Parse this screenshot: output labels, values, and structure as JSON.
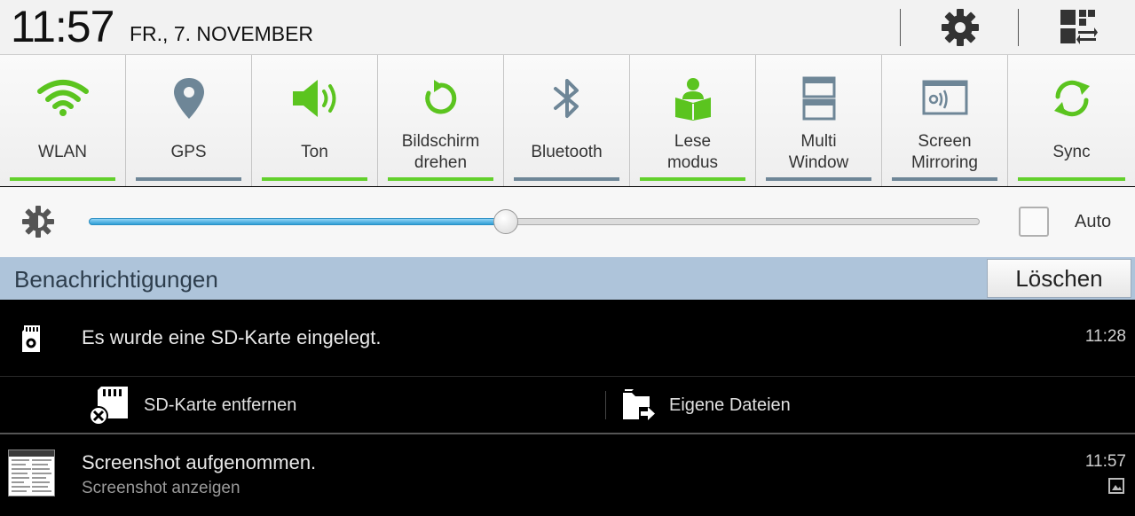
{
  "status": {
    "time": "11:57",
    "date": "FR., 7. NOVEMBER"
  },
  "header_icons": {
    "settings": "gear-icon",
    "multiwindow": "multi-window-icon"
  },
  "toggles": [
    {
      "label": "WLAN",
      "icon": "wifi-icon",
      "on": true
    },
    {
      "label": "GPS",
      "icon": "location-pin-icon",
      "on": false
    },
    {
      "label": "Ton",
      "icon": "speaker-icon",
      "on": true
    },
    {
      "label": "Bildschirm\ndrehen",
      "icon": "rotate-icon",
      "on": true
    },
    {
      "label": "Bluetooth",
      "icon": "bluetooth-icon",
      "on": false
    },
    {
      "label": "Lese\nmodus",
      "icon": "reading-mode-icon",
      "on": true
    },
    {
      "label": "Multi\nWindow",
      "icon": "multi-window-icon",
      "on": false
    },
    {
      "label": "Screen\nMirroring",
      "icon": "screen-mirroring-icon",
      "on": false
    },
    {
      "label": "Sync",
      "icon": "sync-icon",
      "on": true
    }
  ],
  "brightness": {
    "level": 0.468,
    "auto_label": "Auto",
    "auto_checked": false
  },
  "notifications": {
    "header": "Benachrichtigungen",
    "clear_label": "Löschen",
    "items": [
      {
        "text": "Es wurde eine SD-Karte eingelegt.",
        "time": "11:28",
        "icon": "sd-card-icon",
        "actions": [
          {
            "label": "SD-Karte entfernen",
            "icon": "sd-card-remove-icon"
          },
          {
            "label": "Eigene Dateien",
            "icon": "my-files-icon"
          }
        ]
      },
      {
        "title": "Screenshot aufgenommen.",
        "subtitle": "Screenshot anzeigen",
        "time": "11:57",
        "icon": "screenshot-thumbnail"
      }
    ]
  },
  "colors": {
    "toggle_on": "#62d02b",
    "toggle_off": "#6e8697",
    "notif_header_bg": "#aec4da",
    "slider_fill": "#2f9fd6"
  }
}
